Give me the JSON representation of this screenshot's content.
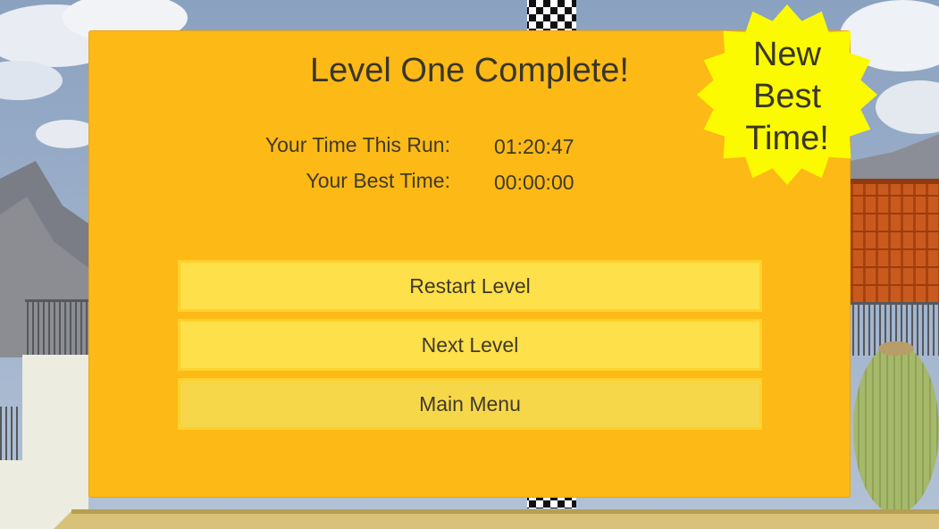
{
  "dialog": {
    "title": "Level One Complete!",
    "stats": [
      {
        "label": "Your Time This Run:",
        "value": "01:20:47"
      },
      {
        "label": "Your Best Time:",
        "value": "00:00:00"
      }
    ],
    "buttons": {
      "restart": "Restart Level",
      "next": "Next Level",
      "main_menu": "Main Menu"
    }
  },
  "badge": {
    "lines": [
      "New",
      "Best",
      "Time!"
    ],
    "color": "#fbfa00"
  },
  "colors": {
    "panel": "#fdb916",
    "button": "#fde04a",
    "sky": "#8ea6c4"
  }
}
